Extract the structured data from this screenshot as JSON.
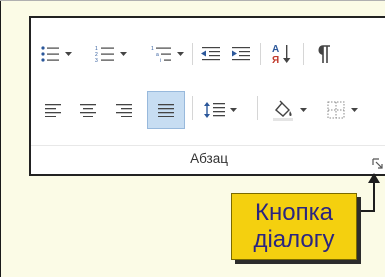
{
  "ribbon": {
    "group_label": "Абзац",
    "row1": [
      {
        "name": "bullets-icon",
        "has_drop": true
      },
      {
        "name": "numbering-icon",
        "has_drop": true
      },
      {
        "name": "multilevel-list-icon",
        "has_drop": true
      },
      {
        "name": "decrease-indent-icon",
        "has_drop": false
      },
      {
        "name": "increase-indent-icon",
        "has_drop": false
      },
      {
        "name": "sort-icon",
        "has_drop": false
      },
      {
        "name": "show-formatting-marks-icon",
        "has_drop": false
      }
    ],
    "row2": [
      {
        "name": "align-left-icon",
        "has_drop": false
      },
      {
        "name": "align-center-icon",
        "has_drop": false
      },
      {
        "name": "align-right-icon",
        "has_drop": false
      },
      {
        "name": "justify-icon",
        "has_drop": false,
        "active": true
      },
      {
        "name": "line-spacing-icon",
        "has_drop": true
      },
      {
        "name": "shading-icon",
        "has_drop": true
      },
      {
        "name": "borders-icon",
        "has_drop": true
      }
    ]
  },
  "callout": {
    "line1": "Кнопка",
    "line2": "діалогу"
  },
  "colors": {
    "background": "#fbfbe6",
    "callout_fill": "#f4d00f",
    "callout_text": "#2b2580",
    "active_button": "#c7ddf2",
    "icon_blue": "#2b579a"
  }
}
